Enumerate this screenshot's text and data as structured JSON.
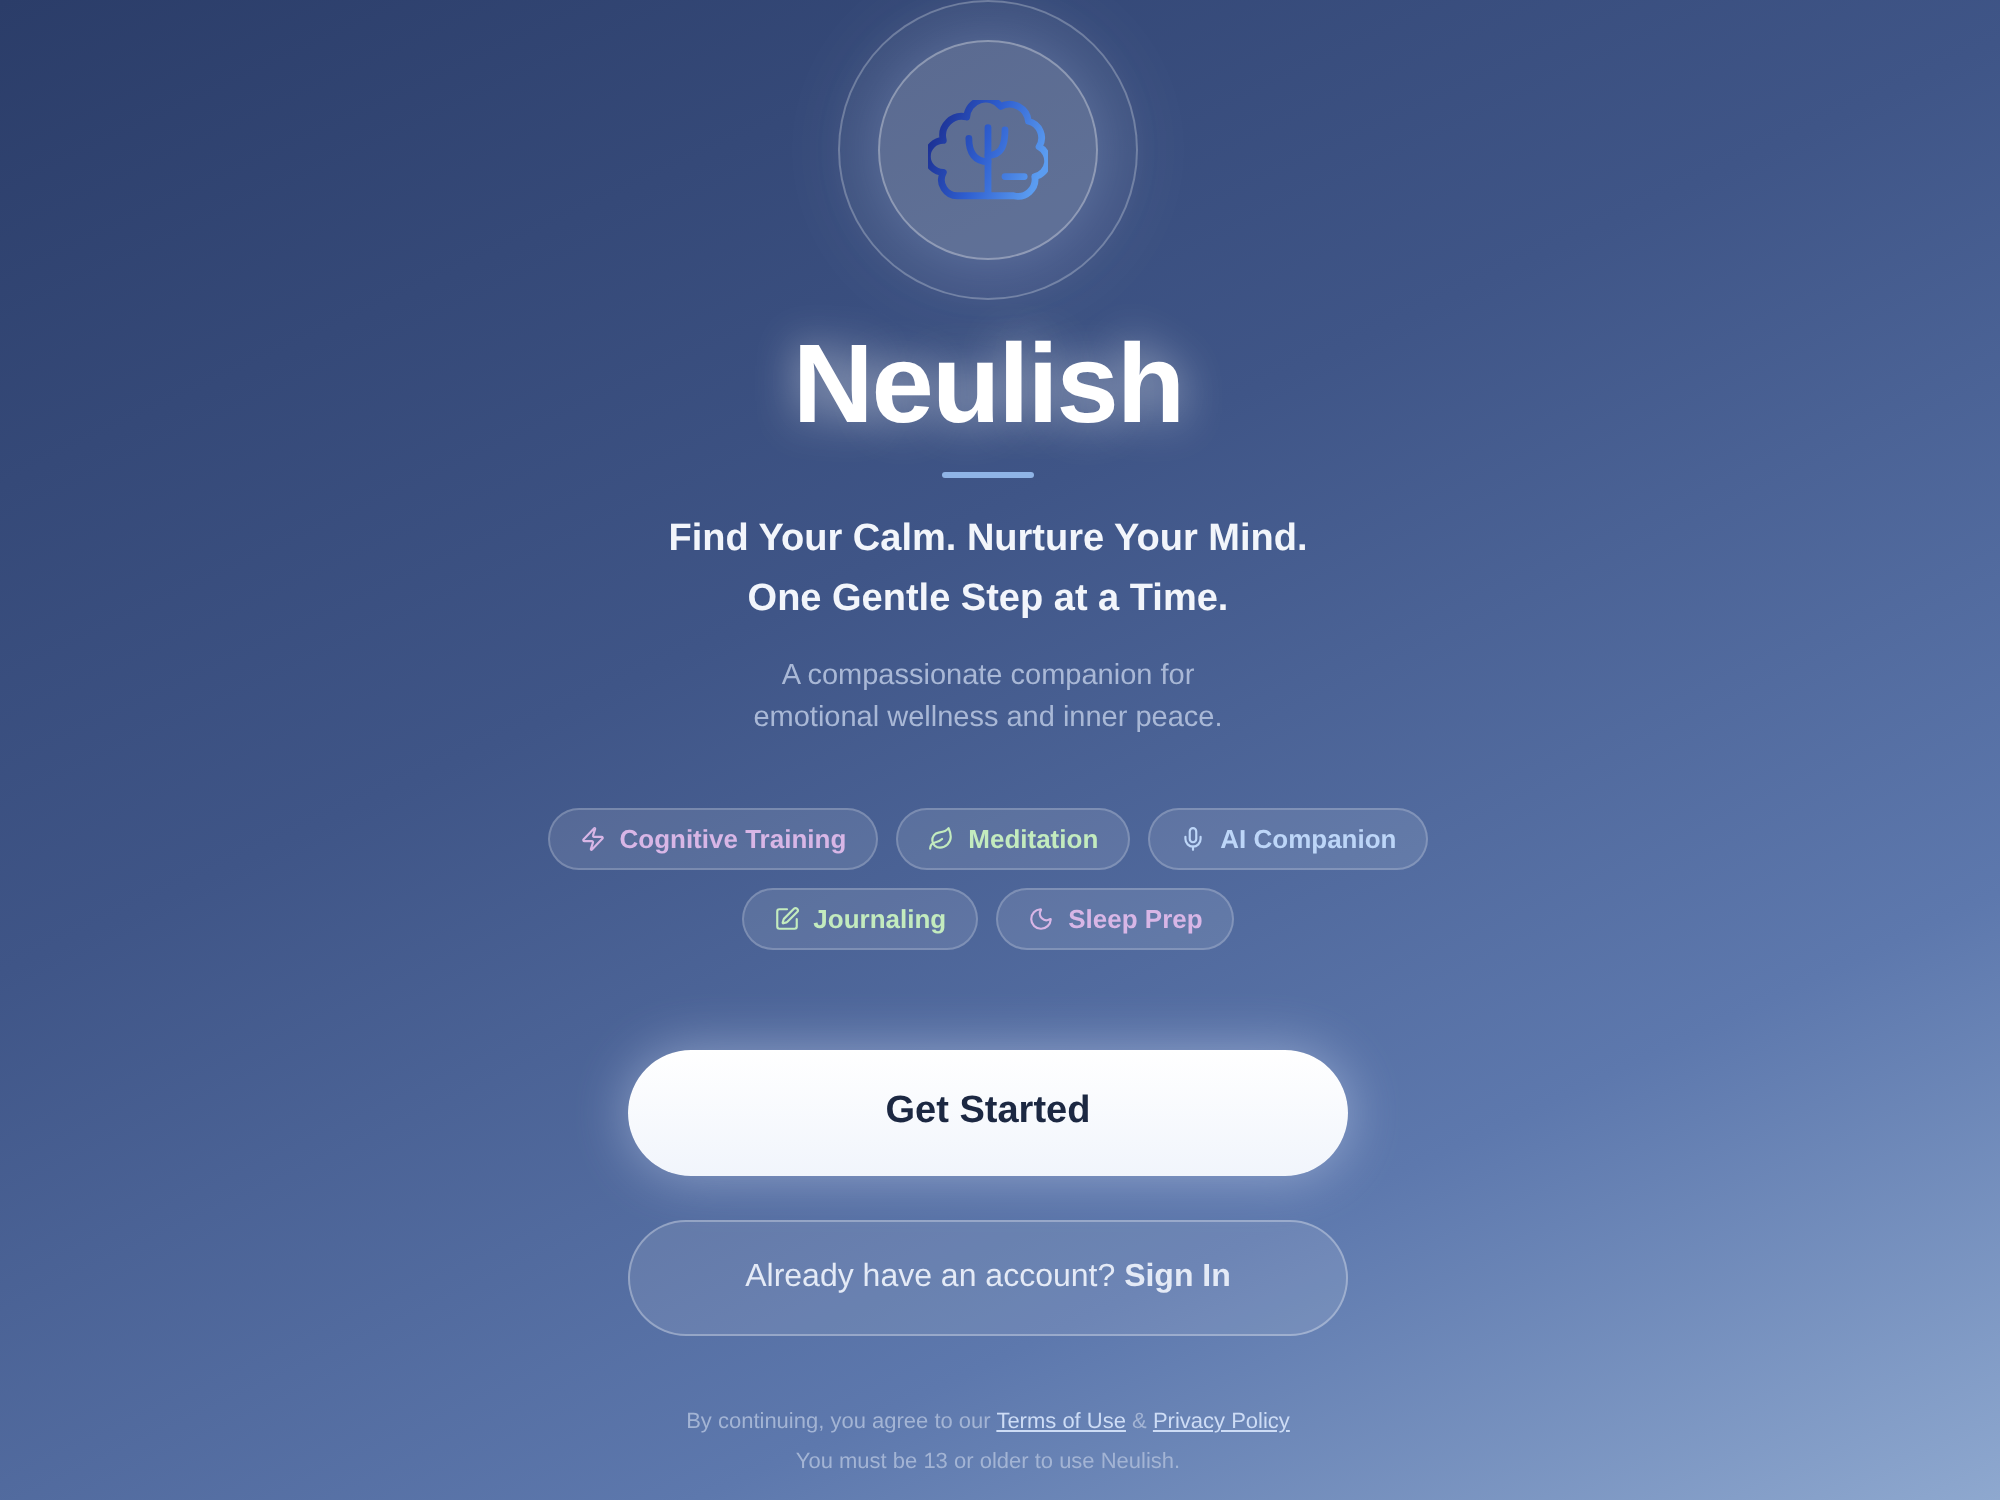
{
  "brand": {
    "name": "Neulish"
  },
  "tagline": [
    "Find Your Calm. Nurture Your Mind.",
    "One Gentle Step at a Time."
  ],
  "description": [
    "A compassionate companion for",
    "emotional wellness and inner peace."
  ],
  "features": [
    [
      {
        "label": "Cognitive Training",
        "kind": "bolt",
        "color": "#d8b6e6"
      },
      {
        "label": "Meditation",
        "kind": "leaf",
        "color": "#c3ebbe"
      },
      {
        "label": "AI Companion",
        "kind": "mic",
        "color": "#bdd6f8"
      }
    ],
    [
      {
        "label": "Journaling",
        "kind": "edit",
        "color": "#c3ebbe"
      },
      {
        "label": "Sleep Prep",
        "kind": "moon",
        "color": "#d8b6e6"
      }
    ]
  ],
  "primary_button": {
    "label": "Get Started"
  },
  "secondary_button": {
    "label": "Already have an account? **Sign In**"
  },
  "legal": {
    "text_before": "By continuing, you agree to our",
    "links": [
      "Terms of Use",
      "Privacy Policy"
    ],
    "joiner": "&",
    "age_note": "You must be 13 or older to use Neulish."
  }
}
